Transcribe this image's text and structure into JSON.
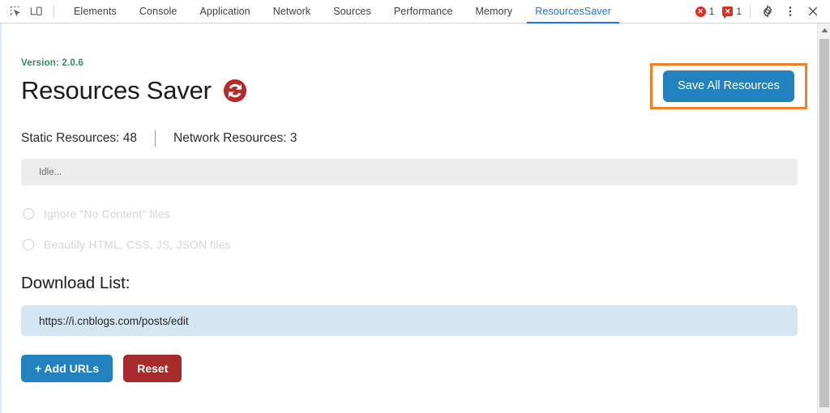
{
  "devtools": {
    "icons": {
      "inspect": "inspect-element-icon",
      "device": "device-toolbar-icon",
      "settings": "gear-icon",
      "more": "kebab-menu-icon",
      "close": "close-icon"
    },
    "tabs": [
      {
        "label": "Elements",
        "active": false
      },
      {
        "label": "Console",
        "active": false
      },
      {
        "label": "Application",
        "active": false
      },
      {
        "label": "Network",
        "active": false
      },
      {
        "label": "Sources",
        "active": false
      },
      {
        "label": "Performance",
        "active": false
      },
      {
        "label": "Memory",
        "active": false
      },
      {
        "label": "ResourcesSaver",
        "active": true
      }
    ],
    "counters": {
      "errors": "1",
      "warnings_messages": "1"
    },
    "accent_active_tab": "#1a73e8"
  },
  "panel": {
    "version_label": "Version: 2.0.6",
    "version_color": "#2e8b57",
    "title": "Resources Saver",
    "refresh_icon": "refresh-sync-icon",
    "refresh_icon_color": "#b52b2b",
    "save_button": {
      "label": "Save All Resources",
      "color": "#2182bd",
      "highlight_color": "#f08023"
    },
    "counts": {
      "static": "Static Resources: 48",
      "network": "Network Resources: 3"
    },
    "status": "Idle...",
    "options": [
      {
        "label": "Ignore \"No Content\" files",
        "checked": false,
        "disabled": true
      },
      {
        "label": "Beautify HTML, CSS, JS, JSON files",
        "checked": false,
        "disabled": true
      }
    ],
    "download_list": {
      "title": "Download List:",
      "items": [
        "https://i.cnblogs.com/posts/edit"
      ],
      "item_bg": "#d4e6f2"
    },
    "actions": [
      {
        "label": "+ Add URLs",
        "color": "#2182bd"
      },
      {
        "label": "Reset",
        "color": "#a62b2b"
      }
    ]
  }
}
